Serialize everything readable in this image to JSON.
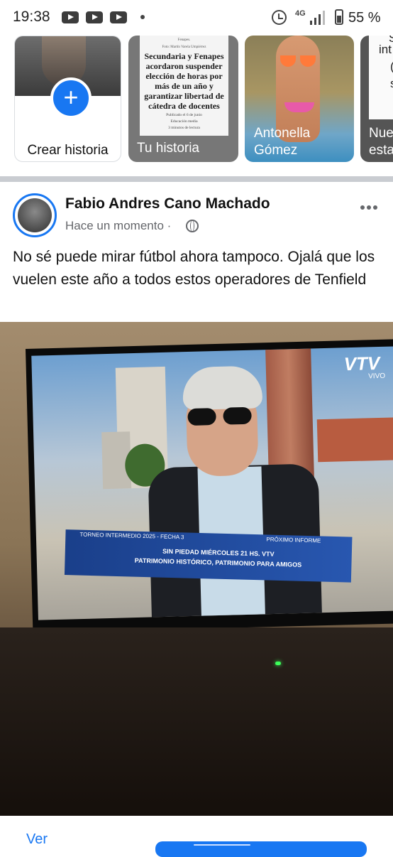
{
  "status_bar": {
    "time": "19:38",
    "battery": "55 %",
    "network": "4G"
  },
  "stories": {
    "create": {
      "label": "Crear historia"
    },
    "yours": {
      "label": "Tu historia",
      "caption_top": "Fenapes.",
      "caption_credit": "Foto: Martín Varela Umpiérrez",
      "headline": "Secundaria y Fenapes acordaron suspender elección de horas por más de un año y garantizar libertad de cátedra de docentes",
      "published": "Publicado el 6 de junio",
      "section": "Educación media",
      "read_time": "3 minutos de lectura"
    },
    "friend": {
      "label_line1": "Antonella",
      "label_line2": "Gómez"
    },
    "partial": {
      "card_t1": "S",
      "card_t2": "int",
      "card_t3": "(",
      "card_t4": "s",
      "label_line1": "Nue",
      "label_line2": "esta"
    }
  },
  "post": {
    "author": "Fabio Andres Cano Machado",
    "time": "Hace un momento",
    "separator": "·",
    "text": "No sé puede mirar fútbol ahora tampoco. Ojalá que los vuelen este año a todos estos operadores de Tenfield",
    "image": {
      "logo": "VTV",
      "logo_sub": "VIVO",
      "ticker_left": "TORNEO INTERMEDIO 2025 - FECHA 3",
      "ticker_right": "PRÓXIMO INFORME",
      "ticker_line1": "SIN PIEDAD MIÉRCOLES 21 HS. VTV",
      "ticker_line2": "PATRIMONIO HISTÓRICO, PATRIMONIO PARA AMIGOS"
    }
  },
  "bottom": {
    "ver": "Ver"
  }
}
